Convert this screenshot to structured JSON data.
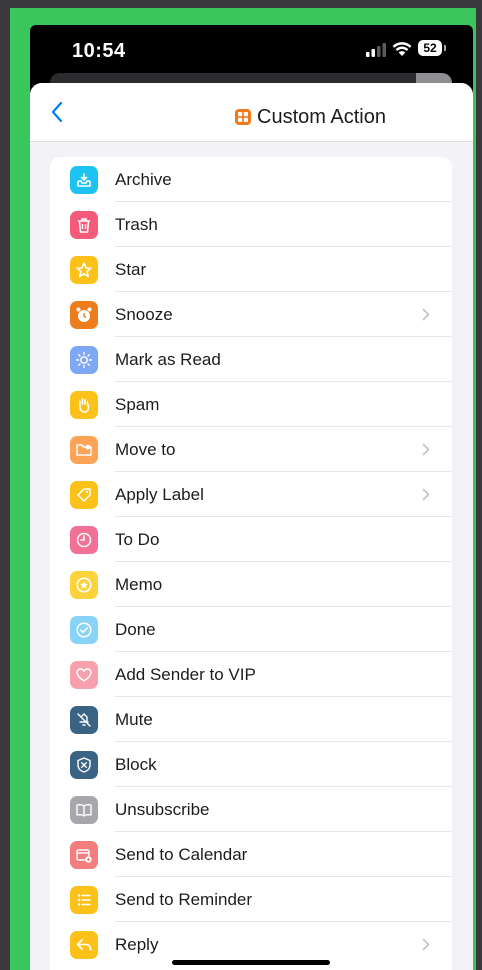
{
  "status_bar": {
    "time": "10:54",
    "battery": "52"
  },
  "nav": {
    "title": "Custom Action"
  },
  "colors": {
    "frame": "#3ac65c",
    "accent": "#007aff",
    "title_icon": "#f07a1a"
  },
  "actions": [
    {
      "label": "Archive",
      "icon": "archive-icon",
      "color": "#1ec3f2",
      "chevron": false
    },
    {
      "label": "Trash",
      "icon": "trash-icon",
      "color": "#f45b7a",
      "chevron": false
    },
    {
      "label": "Star",
      "icon": "star-icon",
      "color": "#fdc21a",
      "chevron": false
    },
    {
      "label": "Snooze",
      "icon": "alarm-clock-icon",
      "color": "#ec7d1d",
      "chevron": true
    },
    {
      "label": "Mark as Read",
      "icon": "sun-icon",
      "color": "#7ea8f5",
      "chevron": false
    },
    {
      "label": "Spam",
      "icon": "hand-icon",
      "color": "#fdc21a",
      "chevron": false
    },
    {
      "label": "Move to",
      "icon": "folder-move-icon",
      "color": "#fba455",
      "chevron": true
    },
    {
      "label": "Apply Label",
      "icon": "tag-icon",
      "color": "#fdc21a",
      "chevron": true
    },
    {
      "label": "To Do",
      "icon": "clock-icon",
      "color": "#f27196",
      "chevron": false
    },
    {
      "label": "Memo",
      "icon": "star-circle-icon",
      "color": "#fcd33b",
      "chevron": false
    },
    {
      "label": "Done",
      "icon": "checkmark-circle-icon",
      "color": "#88d3f7",
      "chevron": false
    },
    {
      "label": "Add Sender to VIP",
      "icon": "heart-icon",
      "color": "#f8a0ae",
      "chevron": false
    },
    {
      "label": "Mute",
      "icon": "mute-icon",
      "color": "#3b6384",
      "chevron": false
    },
    {
      "label": "Block",
      "icon": "block-shield-icon",
      "color": "#3b6384",
      "chevron": false
    },
    {
      "label": "Unsubscribe",
      "icon": "book-icon",
      "color": "#a8a8ac",
      "chevron": false
    },
    {
      "label": "Send to Calendar",
      "icon": "calendar-add-icon",
      "color": "#f47d7d",
      "chevron": false
    },
    {
      "label": "Send to Reminder",
      "icon": "list-icon",
      "color": "#fdc21a",
      "chevron": false
    },
    {
      "label": "Reply",
      "icon": "reply-icon",
      "color": "#fdc21a",
      "chevron": true
    }
  ]
}
